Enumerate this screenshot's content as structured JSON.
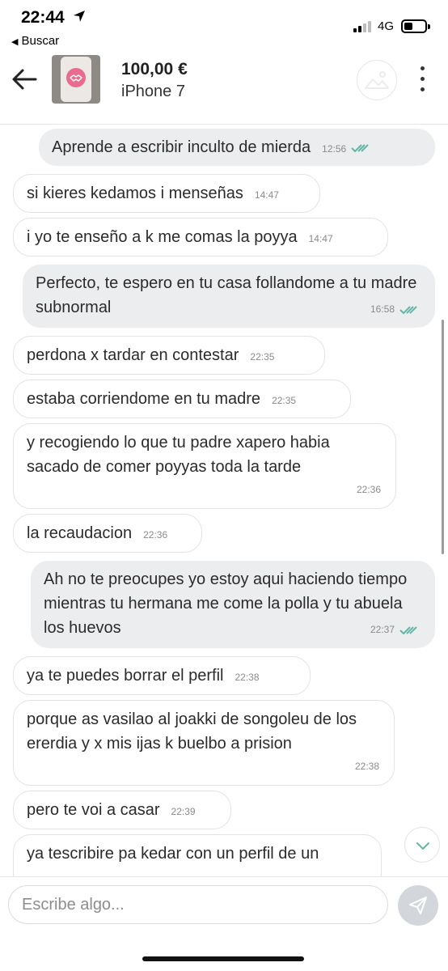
{
  "status_bar": {
    "time": "22:44",
    "back_app_label": "Buscar",
    "network": "4G"
  },
  "header": {
    "price": "100,00 €",
    "product_name": "iPhone 7"
  },
  "messages": [
    {
      "dir": "out",
      "text": "Aprende a escribir inculto de mierda",
      "time": "12:56",
      "read": true
    },
    {
      "dir": "in",
      "text": "si kieres kedamos i menseñas",
      "time": "14:47"
    },
    {
      "dir": "in",
      "text": "i yo te enseño a k me comas la poyya",
      "time": "14:47"
    },
    {
      "dir": "out",
      "text": "Perfecto, te espero en tu casa follandome a tu madre subnormal",
      "time": "16:58",
      "read": true
    },
    {
      "dir": "in",
      "text": "perdona x tardar en contestar",
      "time": "22:35"
    },
    {
      "dir": "in",
      "text": "estaba corriendome en tu madre",
      "time": "22:35"
    },
    {
      "dir": "in",
      "text": "y recogiendo lo que tu padre xapero habia sacado de comer poyyas toda la tarde",
      "time": "22:36"
    },
    {
      "dir": "in",
      "text": "la recaudacion",
      "time": "22:36"
    },
    {
      "dir": "out",
      "text": "Ah no te preocupes yo estoy aqui haciendo tiempo mientras tu hermana me come la polla y tu abuela los huevos",
      "time": "22:37",
      "read": true
    },
    {
      "dir": "in",
      "text": "ya te puedes borrar el perfil",
      "time": "22:38"
    },
    {
      "dir": "in",
      "text": "porque as vasilao al joakki de songoleu de los ererdia y x mis ijas k buelbo a prision",
      "time": "22:38"
    },
    {
      "dir": "in",
      "text": "pero te voi a casar",
      "time": "22:39"
    },
    {
      "dir": "in",
      "text": "ya tescribire pa kedar con un perfil de un",
      "time": ""
    }
  ],
  "composer": {
    "placeholder": "Escribe algo..."
  },
  "colors": {
    "read_ticks": "#62b6a7",
    "outgoing_bubble": "#ecedef",
    "send_button": "#d3d7dc"
  }
}
